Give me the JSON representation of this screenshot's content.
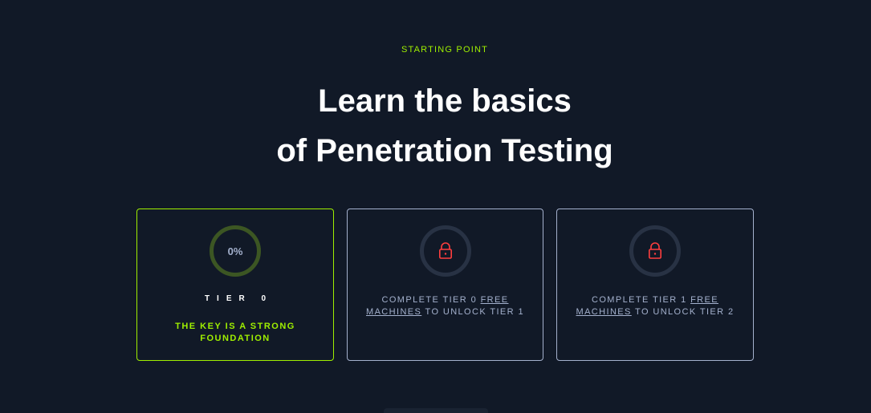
{
  "header": {
    "eyebrow": "STARTING POINT",
    "title_line1": "Learn the basics",
    "title_line2": "of Penetration Testing"
  },
  "tiers": [
    {
      "status": "active",
      "progress_text": "0%",
      "progress": 0,
      "label": "TIER 0",
      "tagline": "THE KEY IS A STRONG FOUNDATION"
    },
    {
      "status": "locked",
      "icon": "lock-icon",
      "text_before": "COMPLETE TIER 0 ",
      "link_text": "FREE MACHINES",
      "text_after": " TO UNLOCK TIER 1"
    },
    {
      "status": "locked",
      "icon": "lock-icon",
      "text_before": "COMPLETE TIER 1 ",
      "link_text": "FREE MACHINES",
      "text_after": " TO UNLOCK TIER 2"
    }
  ],
  "colors": {
    "background": "#111927",
    "accent": "#9fef00",
    "muted_text": "#a4b1cd",
    "lock": "#ff3e3e",
    "card_border": "#a4b1cd"
  }
}
